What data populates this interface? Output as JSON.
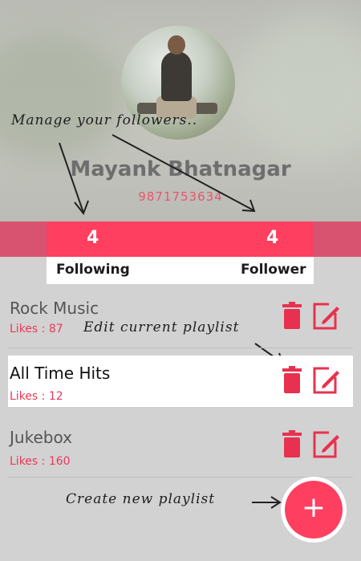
{
  "profile": {
    "name": "Mayank Bhatnagar",
    "phone": "9871753634"
  },
  "stats": {
    "following_count": "4",
    "following_label": "Following",
    "follower_count": "4",
    "follower_label": "Follower"
  },
  "playlists": [
    {
      "title": "Rock Music",
      "likes": "Likes : 87"
    },
    {
      "title": "All Time Hits",
      "likes": "Likes : 12"
    },
    {
      "title": "Jukebox",
      "likes": "Likes : 160"
    }
  ],
  "annotations": {
    "manage": "Manage your followers..",
    "edit": "Edit current playlist",
    "create": "Create new playlist"
  },
  "fab": {
    "label": "+"
  },
  "colors": {
    "accent": "#ff3f60",
    "accent_dark": "#d85370",
    "likes_text": "#e63a59"
  },
  "icons": [
    "trash-icon",
    "edit-icon",
    "plus-icon",
    "arrow-icon"
  ]
}
